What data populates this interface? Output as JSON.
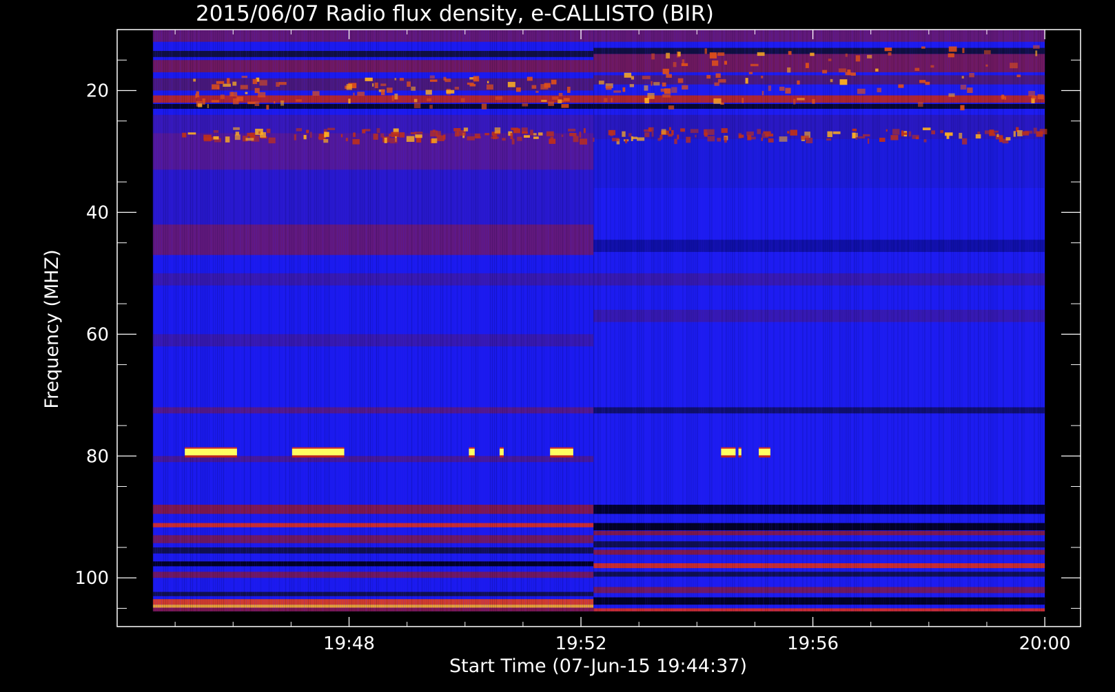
{
  "chart_data": {
    "type": "heatmap",
    "title": "2015/06/07  Radio flux density, e-CALLISTO (BIR)",
    "xlabel": "Start Time (07-Jun-15 19:44:37)",
    "ylabel": "Frequency (MHZ)",
    "x_ticks": [
      "19:48",
      "19:52",
      "19:56",
      "20:00"
    ],
    "x_tick_minutes": [
      3.383,
      7.383,
      11.383,
      15.383
    ],
    "x_range_minutes": [
      -0.617,
      16.0
    ],
    "data_range_minutes": [
      0.0,
      15.383
    ],
    "y_ticks": [
      20,
      40,
      60,
      80,
      100
    ],
    "y_range": [
      10,
      108
    ],
    "y_reversed": true,
    "data_freq_range": [
      10,
      105.5
    ],
    "colormap": [
      "#000000",
      "#1414ff",
      "#8a1a3c",
      "#e0301a",
      "#ffd020",
      "#ffff80"
    ],
    "segments": [
      {
        "minutes": [
          0.0,
          7.6
        ],
        "background": "#1a1aee",
        "bands": [
          {
            "freq": [
              10,
              12
            ],
            "color": "#6a1a6a"
          },
          {
            "freq": [
              13.5,
              14.5
            ],
            "color": "#101030"
          },
          {
            "freq": [
              15,
              17
            ],
            "color": "#7a1a50"
          },
          {
            "freq": [
              18,
              20
            ],
            "color": "#501a70"
          },
          {
            "freq": [
              20.8,
              22.0
            ],
            "color": "#c02818"
          },
          {
            "freq": [
              22.2,
              23.0
            ],
            "color": "#05051a"
          },
          {
            "freq": [
              24,
              27
            ],
            "color": "#3a1ab0"
          },
          {
            "freq": [
              27,
              33
            ],
            "color": "#5a1a90"
          },
          {
            "freq": [
              33,
              42
            ],
            "color": "#2a18c8"
          },
          {
            "freq": [
              42,
              47
            ],
            "color": "#6a1a70"
          },
          {
            "freq": [
              50,
              52
            ],
            "color": "#3a1aa8"
          },
          {
            "freq": [
              60,
              62
            ],
            "color": "#3a1aa8"
          },
          {
            "freq": [
              72,
              73
            ],
            "color": "#5a1a80"
          },
          {
            "freq": [
              80,
              81
            ],
            "color": "#4a1a90"
          },
          {
            "freq": [
              88,
              89.5
            ],
            "color": "#8a1a3c"
          },
          {
            "freq": [
              91,
              91.7
            ],
            "color": "#e03018"
          },
          {
            "freq": [
              93,
              94.3
            ],
            "color": "#7a1a50"
          },
          {
            "freq": [
              95,
              96
            ],
            "color": "#101040"
          },
          {
            "freq": [
              97.3,
              98.1
            ],
            "color": "#000010"
          },
          {
            "freq": [
              99,
              100
            ],
            "color": "#7a1a50"
          },
          {
            "freq": [
              102.3,
              103
            ],
            "color": "#101040"
          },
          {
            "freq": [
              103.5,
              104.4
            ],
            "color": "#e8401a"
          },
          {
            "freq": [
              104.4,
              104.9
            ],
            "color": "#ffb020"
          },
          {
            "freq": [
              104.9,
              105.5
            ],
            "color": "#8a1a3c"
          }
        ]
      },
      {
        "minutes": [
          7.6,
          15.383
        ],
        "background": "#1c1cf0",
        "bands": [
          {
            "freq": [
              10,
              12
            ],
            "color": "#6a1a6a"
          },
          {
            "freq": [
              13,
              14
            ],
            "color": "#101030"
          },
          {
            "freq": [
              14,
              17
            ],
            "color": "#7a1a50"
          },
          {
            "freq": [
              17.5,
              19
            ],
            "color": "#501a70"
          },
          {
            "freq": [
              20.8,
              22.0
            ],
            "color": "#c02818"
          },
          {
            "freq": [
              22.2,
              23.0
            ],
            "color": "#05051a"
          },
          {
            "freq": [
              24,
              28
            ],
            "color": "#2a18b8"
          },
          {
            "freq": [
              28,
              36
            ],
            "color": "#1c1cd8"
          },
          {
            "freq": [
              44.5,
              46.5
            ],
            "color": "#1010a0"
          },
          {
            "freq": [
              50,
              52
            ],
            "color": "#3a1aa8"
          },
          {
            "freq": [
              56,
              58
            ],
            "color": "#3a1aa8"
          },
          {
            "freq": [
              72,
              73
            ],
            "color": "#101060"
          },
          {
            "freq": [
              88,
              89.5
            ],
            "color": "#000018"
          },
          {
            "freq": [
              91,
              92.2
            ],
            "color": "#000010"
          },
          {
            "freq": [
              92.3,
              93
            ],
            "color": "#8a1a3c"
          },
          {
            "freq": [
              94,
              95
            ],
            "color": "#101040"
          },
          {
            "freq": [
              95.4,
              96.2
            ],
            "color": "#8a1a3c"
          },
          {
            "freq": [
              97.6,
              98.4
            ],
            "color": "#e03018"
          },
          {
            "freq": [
              99,
              99.8
            ],
            "color": "#101040"
          },
          {
            "freq": [
              101.5,
              102.5
            ],
            "color": "#7a1a50"
          },
          {
            "freq": [
              103.2,
              104.4
            ],
            "color": "#000010"
          },
          {
            "freq": [
              105,
              105.5
            ],
            "color": "#e03018"
          }
        ]
      }
    ],
    "bursts": [
      {
        "minutes": [
          0.55,
          1.45
        ],
        "freq": [
          78.8,
          79.9
        ],
        "color": "#ffff60"
      },
      {
        "minutes": [
          2.4,
          3.3
        ],
        "freq": [
          78.8,
          79.9
        ],
        "color": "#ffff60"
      },
      {
        "minutes": [
          5.45,
          5.55
        ],
        "freq": [
          78.8,
          79.9
        ],
        "color": "#ffff60"
      },
      {
        "minutes": [
          5.98,
          6.05
        ],
        "freq": [
          78.8,
          79.9
        ],
        "color": "#ffff60"
      },
      {
        "minutes": [
          6.85,
          7.25
        ],
        "freq": [
          78.8,
          79.9
        ],
        "color": "#ffff60"
      },
      {
        "minutes": [
          9.8,
          10.05
        ],
        "freq": [
          78.8,
          79.9
        ],
        "color": "#ffff60"
      },
      {
        "minutes": [
          10.1,
          10.15
        ],
        "freq": [
          78.8,
          79.9
        ],
        "color": "#ffff60"
      },
      {
        "minutes": [
          10.45,
          10.65
        ],
        "freq": [
          78.8,
          79.9
        ],
        "color": "#ffff60"
      },
      {
        "minutes": [
          0.55,
          7.25
        ],
        "freq": [
          17.5,
          22.5
        ],
        "color": "#e05018",
        "sparse": true
      },
      {
        "minutes": [
          7.6,
          15.3
        ],
        "freq": [
          12.5,
          22.5
        ],
        "color": "#e05018",
        "sparse": true
      },
      {
        "minutes": [
          0.5,
          15.3
        ],
        "freq": [
          26,
          28
        ],
        "color": "#c03018",
        "sparse": true
      }
    ]
  }
}
